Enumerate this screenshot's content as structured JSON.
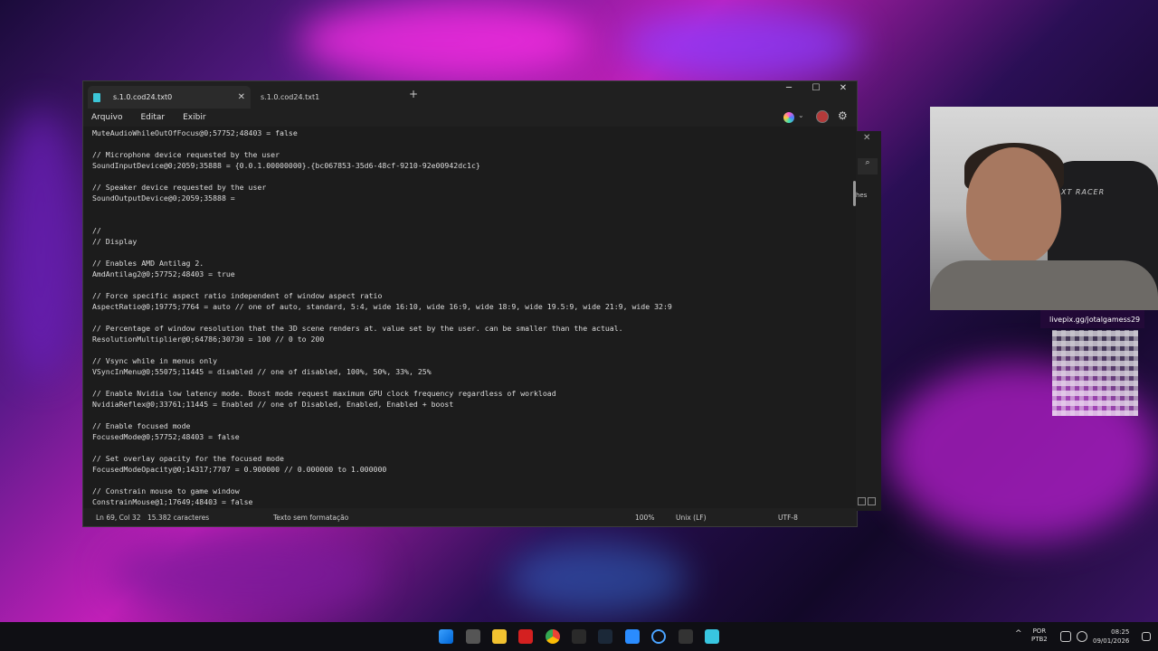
{
  "window": {
    "tabs": [
      {
        "label": "s.1.0.cod24.txt0",
        "active": true
      },
      {
        "label": "s.1.0.cod24.txt1",
        "active": false
      }
    ],
    "new_tab": "+",
    "controls": {
      "minimize": "─",
      "maximize": "☐",
      "close": "✕"
    }
  },
  "menu": [
    "Arquivo",
    "Editar",
    "Exibir"
  ],
  "icons": {
    "copilot": "copilot-icon",
    "account": "avatar",
    "settings": "gear-icon",
    "settings_glyph": "⚙",
    "caret_glyph": "⌄"
  },
  "editor": {
    "lines": [
      "MuteAudioWhileOutOfFocus@0;57752;48403 = false",
      "",
      "// Microphone device requested by the user",
      "SoundInputDevice@0;2059;35888 = {0.0.1.00000000}.{bc067853-35d6-48cf-9210-92e00942dc1c}",
      "",
      "// Speaker device requested by the user",
      "SoundOutputDevice@0;2059;35888 = ",
      "",
      "",
      "//",
      "// Display",
      "",
      "// Enables AMD Antilag 2.",
      "AmdAntilag2@0;57752;48403 = true",
      "",
      "// Force specific aspect ratio independent of window aspect ratio",
      "AspectRatio@0;19775;7764 = auto // one of auto, standard, 5:4, wide 16:10, wide 16:9, wide 18:9, wide 19.5:9, wide 21:9, wide 32:9",
      "",
      "// Percentage of window resolution that the 3D scene renders at. value set by the user. can be smaller than the actual.",
      "ResolutionMultiplier@0;64786;30730 = 100 // 0 to 200",
      "",
      "// Vsync while in menus only",
      "VSyncInMenu@0;55075;11445 = disabled // one of disabled, 100%, 50%, 33%, 25%",
      "",
      "// Enable Nvidia low latency mode. Boost mode request maximum GPU clock frequency regardless of workload",
      "NvidiaReflex@0;33761;11445 = Enabled // one of Disabled, Enabled, Enabled + boost",
      "",
      "// Enable focused mode",
      "FocusedMode@0;57752;48403 = false",
      "",
      "// Set overlay opacity for the focused mode",
      "FocusedModeOpacity@0;14317;7707 = 0.900000 // 0.000000 to 1.000000",
      "",
      "// Constrain mouse to game window",
      "ConstrainMouse@1;17649;48403 = false"
    ]
  },
  "status": {
    "position": "Ln 69, Col 32",
    "chars": "15.382 caracteres",
    "format": "Texto sem formatação",
    "zoom": "100%",
    "eol": "Unix (LF)",
    "encoding": "UTF-8"
  },
  "side_panel": {
    "close": "✕",
    "search": "⌕",
    "label": "hes"
  },
  "overlay": {
    "handle": "livepix.gg/jotalgamess29",
    "chair_brand": "XT RACER"
  },
  "taskbar": {
    "apps": [
      "windows-icon",
      "taskview-icon",
      "file-explorer-icon",
      "app-red-icon",
      "chrome-icon",
      "epic-games-icon",
      "steam-icon",
      "app-blue-icon",
      "app-ring-icon",
      "app-g-icon",
      "notepad-icon"
    ],
    "lang": "POR",
    "layout": "PTB2",
    "time": "08:25",
    "date": "09/01/2026",
    "chevron": "^"
  }
}
